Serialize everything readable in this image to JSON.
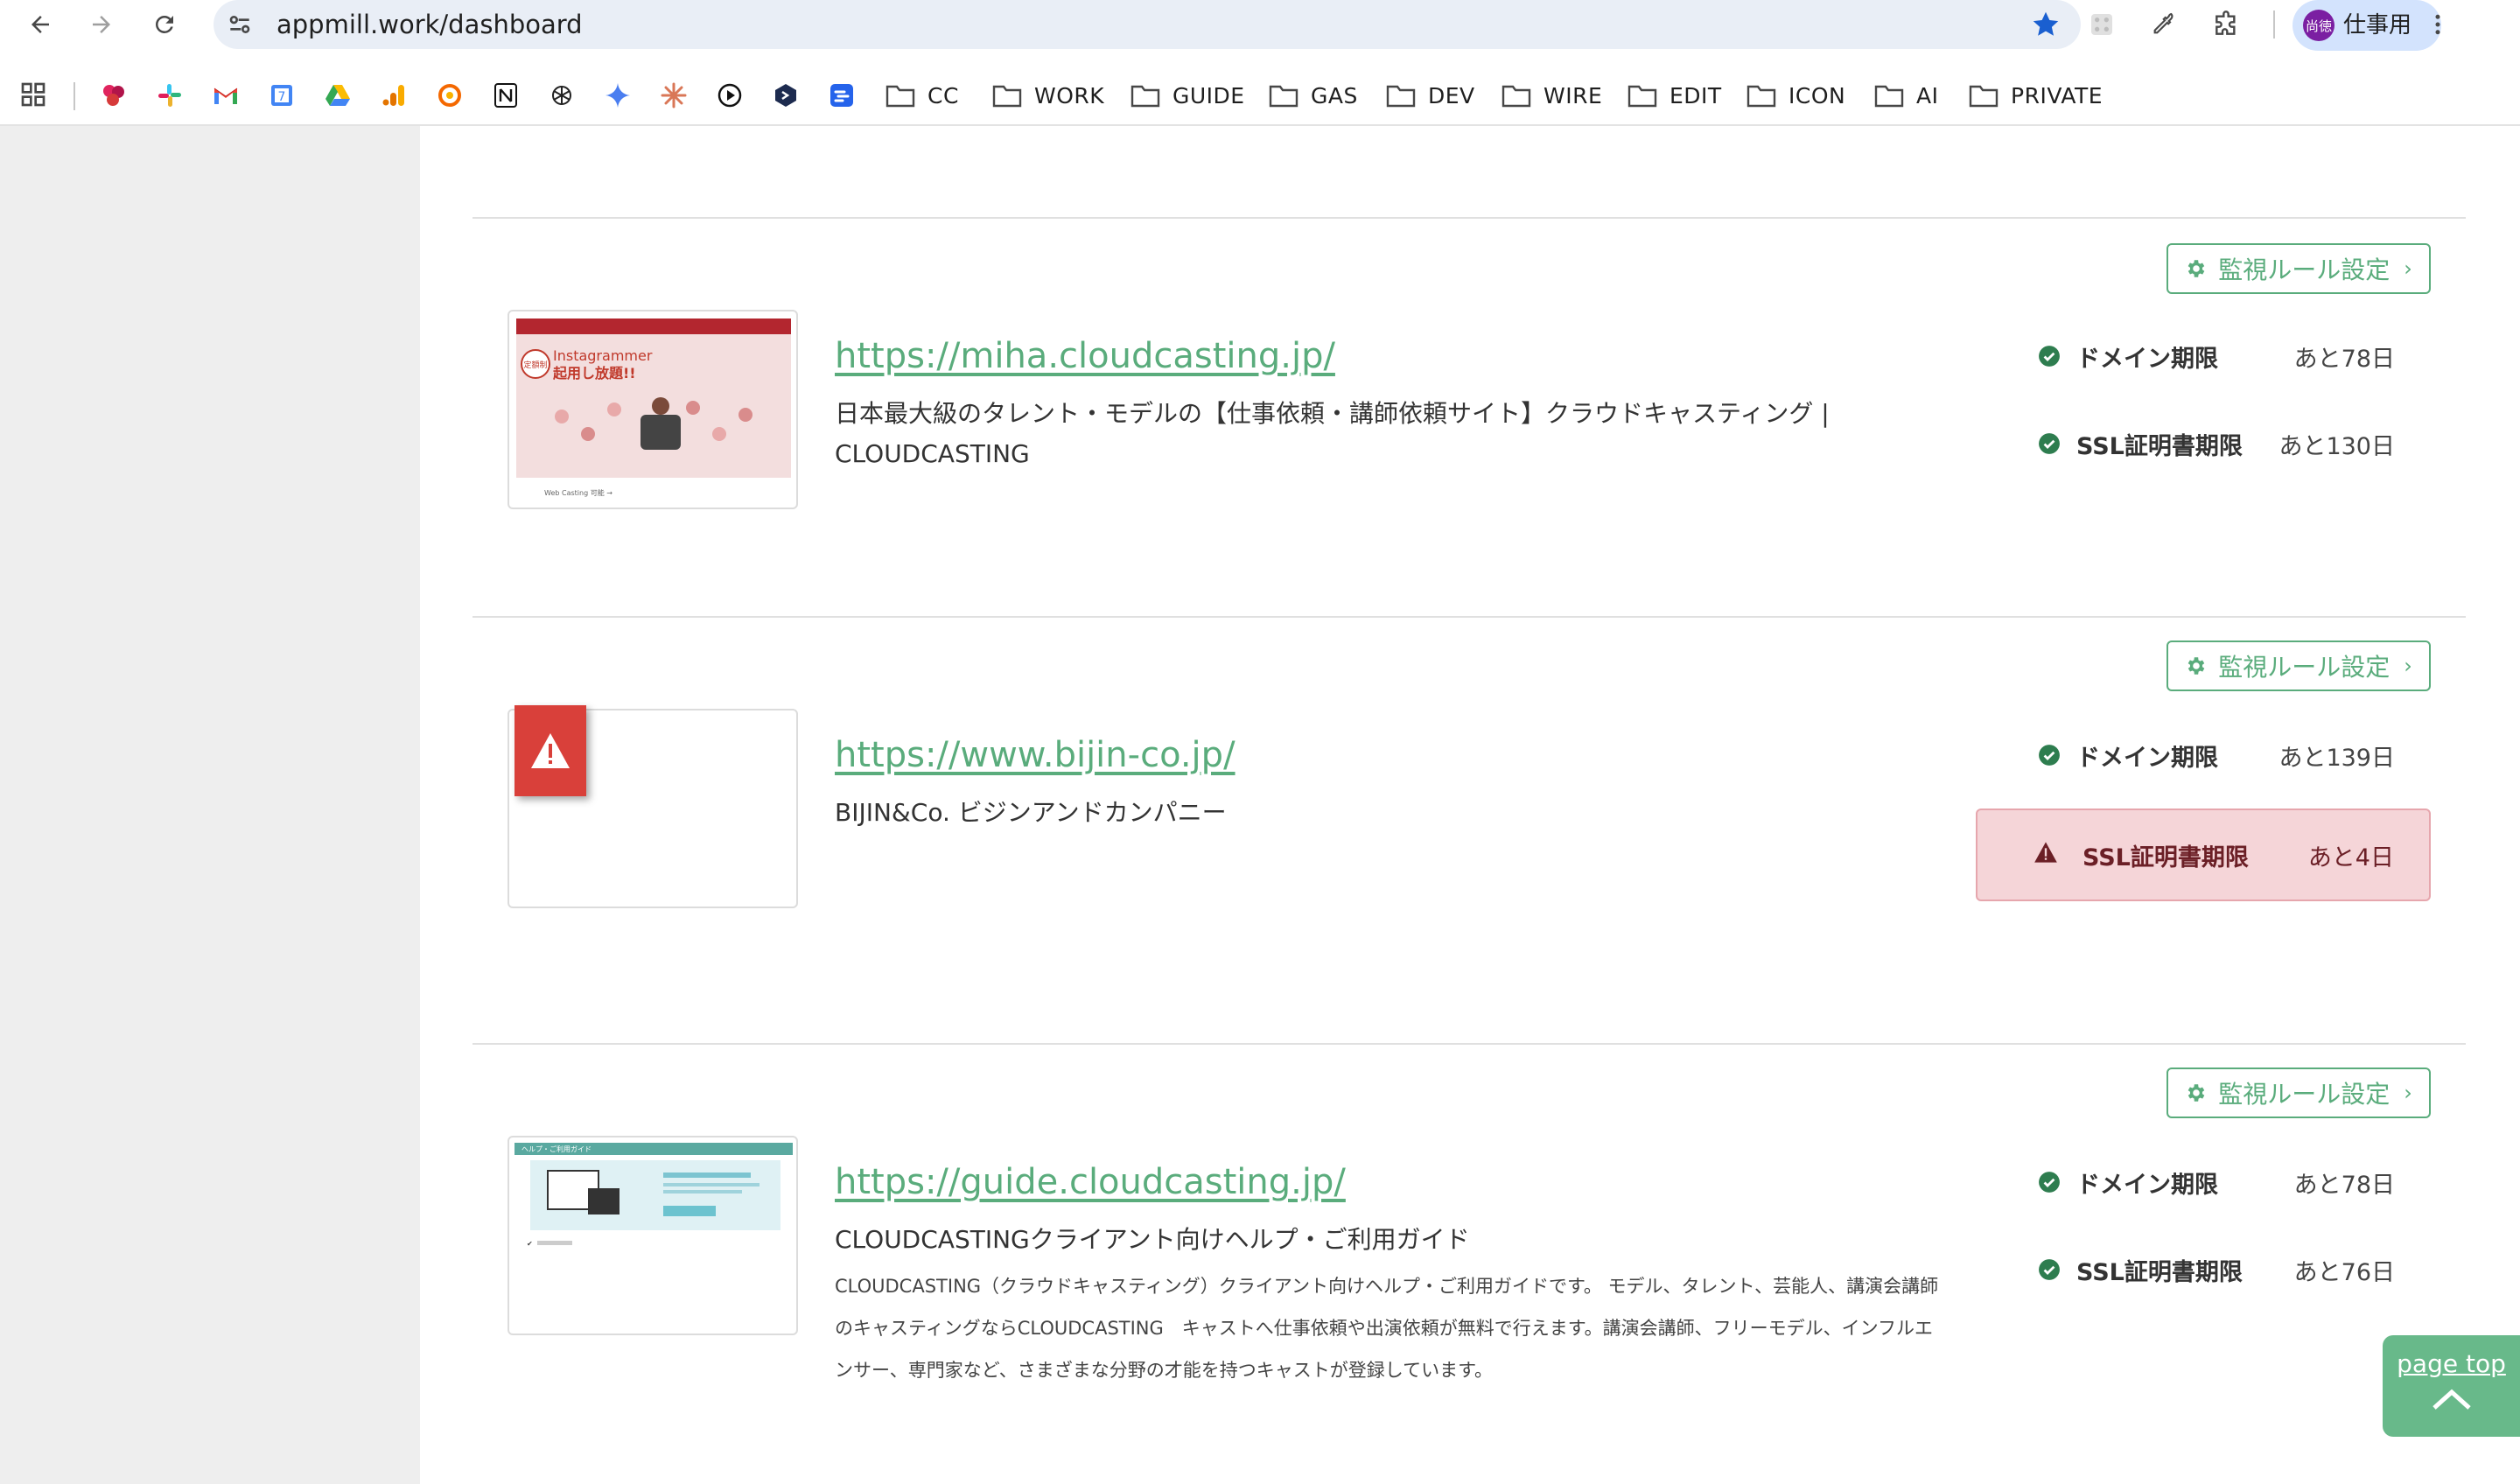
{
  "browser": {
    "url": "appmill.work/dashboard",
    "profile_avatar_text": "尚徳",
    "profile_label": "仕事用",
    "bookmark_folders": [
      "CC",
      "WORK",
      "GUIDE",
      "GAS",
      "DEV",
      "WIRE",
      "EDIT",
      "ICON",
      "AI",
      "PRIVATE"
    ],
    "bookmark_favicons": [
      "multicolor-app-icon",
      "slack-icon",
      "gmail-icon",
      "calendar-icon",
      "google-drive-icon",
      "analytics-icon",
      "grafana-icon",
      "notion-icon",
      "openai-icon",
      "gemini-icon",
      "claude-icon",
      "play-circle-icon",
      "cube-icon",
      "chart-app-icon"
    ]
  },
  "sites": [
    {
      "url": "https://miha.cloudcasting.jp/",
      "title": "日本最大級のタレント・モデルの【仕事依頼・講師依頼サイト】クラウドキャスティング | CLOUDCASTING",
      "description": "",
      "rule_button": "監視ルール設定",
      "thumbnail": {
        "headline": "Instagrammer",
        "subheadline": "起用し放題!!",
        "badge": "定額制",
        "caption": "Web Casting 可能 →"
      },
      "status": [
        {
          "label": "ドメイン期限",
          "value": "あと78日",
          "level": "ok"
        },
        {
          "label": "SSL証明書期限",
          "value": "あと130日",
          "level": "ok"
        }
      ]
    },
    {
      "url": "https://www.bijin-co.jp/",
      "title": "BIJIN&Co. ビジンアンドカンパニー",
      "description": "",
      "rule_button": "監視ルール設定",
      "thumbnail": {
        "error": true
      },
      "status": [
        {
          "label": "ドメイン期限",
          "value": "あと139日",
          "level": "ok"
        },
        {
          "label": "SSL証明書期限",
          "value": "あと4日",
          "level": "alert"
        }
      ]
    },
    {
      "url": "https://guide.cloudcasting.jp/",
      "title": "CLOUDCASTINGクライアント向けヘルプ・ご利用ガイド",
      "description": "CLOUDCASTING（クラウドキャスティング）クライアント向けヘルプ・ご利用ガイドです。 モデル、タレント、芸能人、講演会講師のキャスティングならCLOUDCASTING　キャストへ仕事依頼や出演依頼が無料で行えます。講演会講師、フリーモデル、インフルエンサー、専門家など、さまざまな分野の才能を持つキャストが登録しています。",
      "rule_button": "監視ルール設定",
      "thumbnail": {
        "header": "ヘルプ・ご利用ガイド"
      },
      "status": [
        {
          "label": "ドメイン期限",
          "value": "あと78日",
          "level": "ok"
        },
        {
          "label": "SSL証明書期限",
          "value": "あと76日",
          "level": "ok"
        }
      ]
    }
  ],
  "page_top": {
    "label": "page top"
  },
  "colors": {
    "accent_green": "#5aac7c",
    "alert_bg": "#f5d5d8",
    "alert_text": "#6b1f26",
    "ok_icon": "#2e7d4f",
    "error_badge": "#d9403a"
  }
}
